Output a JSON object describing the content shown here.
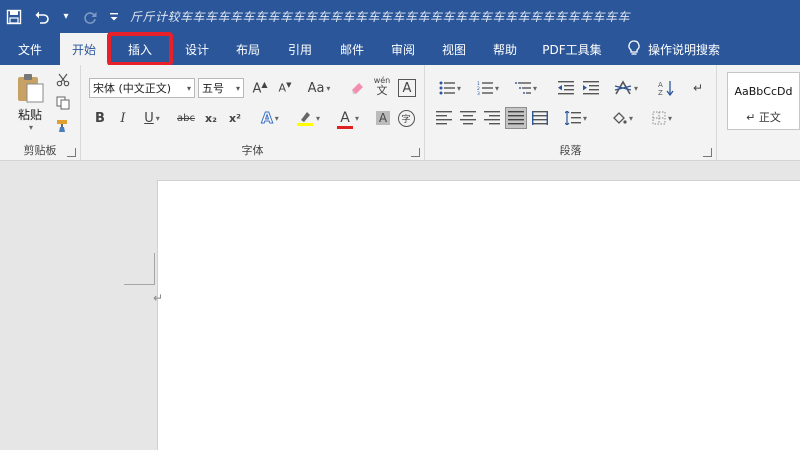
{
  "titlebar": {
    "save_icon": "save-icon",
    "undo_icon": "undo-icon",
    "redo_icon": "redo-icon",
    "customize_icon": "customize-qat-icon",
    "title": "斤斤计较车车车车车车车车车车车车车车车车车车车车车车车车车车车车车车车车车车车车"
  },
  "tabs": [
    {
      "label": "文件",
      "name": "tab-file"
    },
    {
      "label": "开始",
      "name": "tab-home"
    },
    {
      "label": "插入",
      "name": "tab-insert"
    },
    {
      "label": "设计",
      "name": "tab-design"
    },
    {
      "label": "布局",
      "name": "tab-layout"
    },
    {
      "label": "引用",
      "name": "tab-references"
    },
    {
      "label": "邮件",
      "name": "tab-mailings"
    },
    {
      "label": "审阅",
      "name": "tab-review"
    },
    {
      "label": "视图",
      "name": "tab-view"
    },
    {
      "label": "帮助",
      "name": "tab-help"
    },
    {
      "label": "PDF工具集",
      "name": "tab-pdf-tools"
    }
  ],
  "tell_me": "操作说明搜索",
  "clipboard": {
    "label": "剪贴板",
    "paste_label": "粘贴"
  },
  "font": {
    "label": "字体",
    "font_name": "宋体 (中文正文)",
    "font_size": "五号",
    "aa_label": "Aa",
    "bold": "B",
    "italic": "I",
    "underline": "U",
    "strike": "abc",
    "subscript": "x₂",
    "superscript": "x²",
    "pinyin_top": "wén",
    "pinyin_bottom": "文",
    "char_border": "A",
    "text_effects": "A",
    "font_color": "A",
    "char_shading": "A",
    "enclose": "字"
  },
  "paragraph": {
    "label": "段落"
  },
  "styles": {
    "sample": "AaBbCcDd",
    "name": "正文"
  },
  "colors": {
    "brand": "#2b579a",
    "highlight_outline": "#e8202a",
    "font_color_bar": "#e02020",
    "highlight_bar": "#ffff00"
  }
}
